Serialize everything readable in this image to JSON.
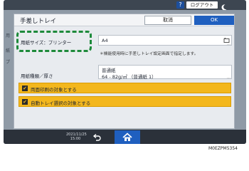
{
  "topbar": {
    "help_label": "?",
    "logout_label": "ログアウト",
    "moon_icon": "moon-icon"
  },
  "background": {
    "frag1": "用",
    "frag2": "紙",
    "frag3": "プ"
  },
  "dialog": {
    "title": "手差しトレイ",
    "cancel_label": "取消",
    "ok_label": "OK",
    "paper_size_label": "用紙サイズ：プリンター",
    "paper_size_value": "A4",
    "note": "＊機能使用時に手差しトレイ設定画面で指定します。",
    "paper_type_label": "用紙種類／厚さ",
    "paper_type_value_line1": "普通紙",
    "paper_type_value_line2": "64 - 82g/㎡ （普通紙 1）",
    "duplex_label": "両面印刷の対象とする",
    "auto_tray_label": "自動トレイ選択の対象とする"
  },
  "bottombar": {
    "date": "2021/11/25",
    "time": "15:00"
  },
  "caption": "M0EZPM5354",
  "colors": {
    "accent_blue": "#1f5fbf",
    "highlight_green": "#1d8a3a",
    "checkbox_row": "#f3b71d"
  }
}
